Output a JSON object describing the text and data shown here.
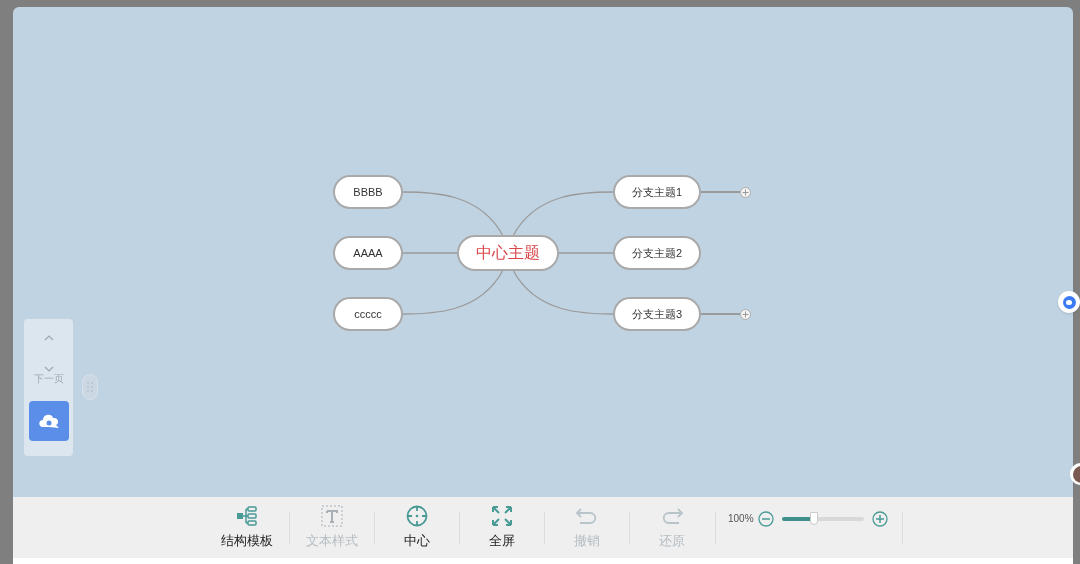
{
  "mindmap": {
    "center": {
      "label": "中心主题"
    },
    "left_nodes": [
      {
        "label": "BBBB"
      },
      {
        "label": "AAAA"
      },
      {
        "label": "ccccc"
      }
    ],
    "right_nodes": [
      {
        "label": "分支主题1",
        "collapsible": true
      },
      {
        "label": "分支主题2",
        "collapsible": false
      },
      {
        "label": "分支主题3",
        "collapsible": true
      }
    ]
  },
  "page_nav": {
    "next_label": "下一页"
  },
  "toolbar": [
    {
      "kind": "structure",
      "label": "结构模板",
      "disabled": false
    },
    {
      "kind": "text",
      "label": "文本样式",
      "disabled": true
    },
    {
      "kind": "center",
      "label": "中心",
      "disabled": false
    },
    {
      "kind": "fullscreen",
      "label": "全屏",
      "disabled": false
    },
    {
      "kind": "undo",
      "label": "撤销",
      "disabled": true
    },
    {
      "kind": "redo",
      "label": "还原",
      "disabled": true
    }
  ],
  "zoom": {
    "reading": "100%",
    "level": 0.4
  }
}
